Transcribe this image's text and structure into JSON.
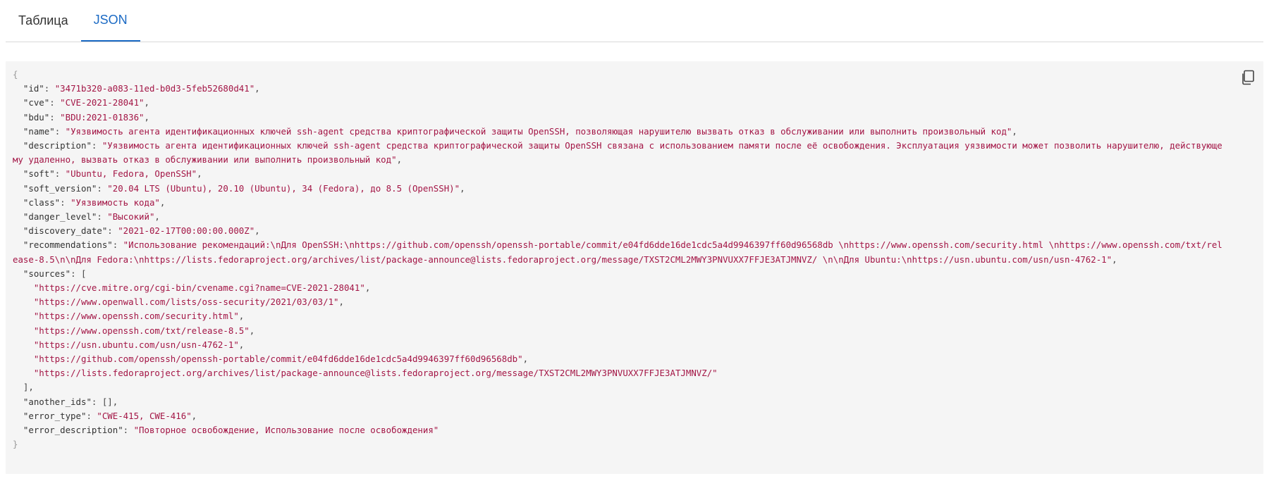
{
  "tabs": [
    {
      "label": "Таблица",
      "active": false
    },
    {
      "label": "JSON",
      "active": true
    }
  ],
  "icons": {
    "copy": "copy-icon"
  },
  "colors": {
    "accent": "#1b6ac4",
    "string": "#a31545",
    "panel_bg": "#f5f5f5"
  },
  "json": {
    "id": "3471b320-a083-11ed-b0d3-5feb52680d41",
    "cve": "CVE-2021-28041",
    "bdu": "BDU:2021-01836",
    "name": "Уязвимость агента идентификационных ключей ssh-agent средства криптографической защиты OpenSSH, позволяющая нарушителю вызвать отказ в обслуживании или выполнить произвольный код",
    "description": "Уязвимость агента идентификационных ключей ssh-agent средства криптографической защиты OpenSSH связана с использованием памяти после её освобождения. Эксплуатация уязвимости может позволить нарушителю, действующему удаленно, вызвать отказ в обслуживании или выполнить произвольный код",
    "soft": "Ubuntu, Fedora, OpenSSH",
    "soft_version": "20.04 LTS (Ubuntu), 20.10 (Ubuntu), 34 (Fedora), до 8.5 (OpenSSH)",
    "class": "Уязвимость кода",
    "danger_level": "Высокий",
    "discovery_date": "2021-02-17T00:00:00.000Z",
    "recommendations": "Использование рекомендаций:\\nДля OpenSSH:\\nhttps://github.com/openssh/openssh-portable/commit/e04fd6dde16de1cdc5a4d9946397ff60d96568db \\nhttps://www.openssh.com/security.html \\nhttps://www.openssh.com/txt/release-8.5\\n\\nДля Fedora:\\nhttps://lists.fedoraproject.org/archives/list/package-announce@lists.fedoraproject.org/message/TXST2CML2MWY3PNVUXX7FFJE3ATJMNVZ/ \\n\\nДля Ubuntu:\\nhttps://usn.ubuntu.com/usn/usn-4762-1",
    "sources": [
      "https://cve.mitre.org/cgi-bin/cvename.cgi?name=CVE-2021-28041",
      "https://www.openwall.com/lists/oss-security/2021/03/03/1",
      "https://www.openssh.com/security.html",
      "https://www.openssh.com/txt/release-8.5",
      "https://usn.ubuntu.com/usn/usn-4762-1",
      "https://github.com/openssh/openssh-portable/commit/e04fd6dde16de1cdc5a4d9946397ff60d96568db",
      "https://lists.fedoraproject.org/archives/list/package-announce@lists.fedoraproject.org/message/TXST2CML2MWY3PNVUXX7FFJE3ATJMNVZ/"
    ],
    "another_ids": [],
    "error_type": "CWE-415, CWE-416",
    "error_description": "Повторное освобождение, Использование после освобождения"
  }
}
